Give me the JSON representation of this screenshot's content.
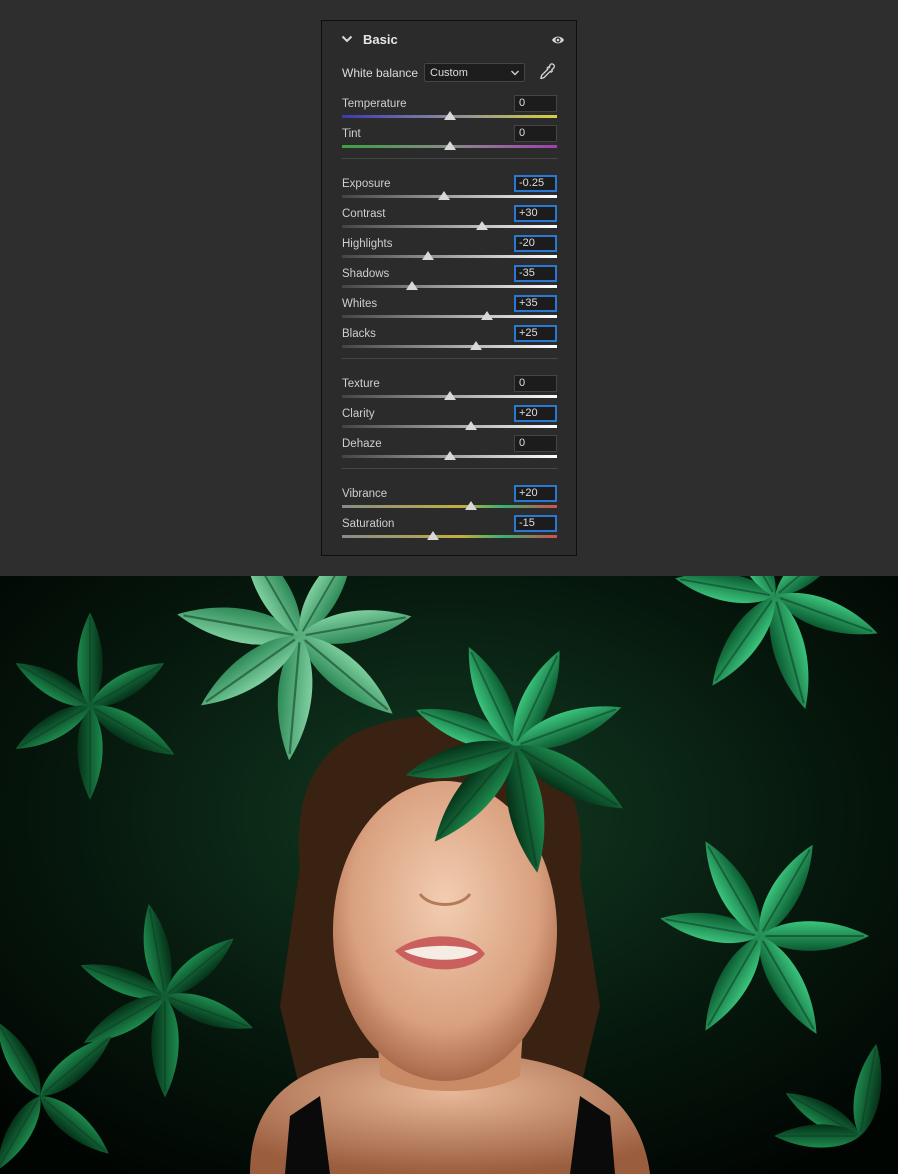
{
  "panel": {
    "title": "Basic",
    "white_balance": {
      "label": "White balance",
      "value": "Custom"
    }
  },
  "groups": [
    [
      {
        "label": "Temperature",
        "value": "0",
        "changed": false,
        "position": 0.5,
        "track": "temperature"
      },
      {
        "label": "Tint",
        "value": "0",
        "changed": false,
        "position": 0.5,
        "track": "tint"
      }
    ],
    [
      {
        "label": "Exposure",
        "value": "-0.25",
        "changed": true,
        "position": 0.475,
        "track": "tone"
      },
      {
        "label": "Contrast",
        "value": "+30",
        "changed": true,
        "position": 0.65,
        "track": "tone"
      },
      {
        "label": "Highlights",
        "value": "-20",
        "changed": true,
        "position": 0.4,
        "track": "tone"
      },
      {
        "label": "Shadows",
        "value": "-35",
        "changed": true,
        "position": 0.325,
        "track": "tone"
      },
      {
        "label": "Whites",
        "value": "+35",
        "changed": true,
        "position": 0.675,
        "track": "tone"
      },
      {
        "label": "Blacks",
        "value": "+25",
        "changed": true,
        "position": 0.625,
        "track": "tone"
      }
    ],
    [
      {
        "label": "Texture",
        "value": "0",
        "changed": false,
        "position": 0.5,
        "track": "tone"
      },
      {
        "label": "Clarity",
        "value": "+20",
        "changed": true,
        "position": 0.6,
        "track": "tone"
      },
      {
        "label": "Dehaze",
        "value": "0",
        "changed": false,
        "position": 0.5,
        "track": "tone"
      }
    ],
    [
      {
        "label": "Vibrance",
        "value": "+20",
        "changed": true,
        "position": 0.6,
        "track": "color"
      },
      {
        "label": "Saturation",
        "value": "-15",
        "changed": true,
        "position": 0.425,
        "track": "color"
      }
    ]
  ],
  "colors": {
    "accent": "#2979d4",
    "panel_bg": "#2b2b2b",
    "page_bg": "#2e2e2e"
  },
  "icons": {
    "collapse": "chevron-down-icon",
    "visibility": "eye-icon",
    "picker": "eyedropper-icon"
  }
}
